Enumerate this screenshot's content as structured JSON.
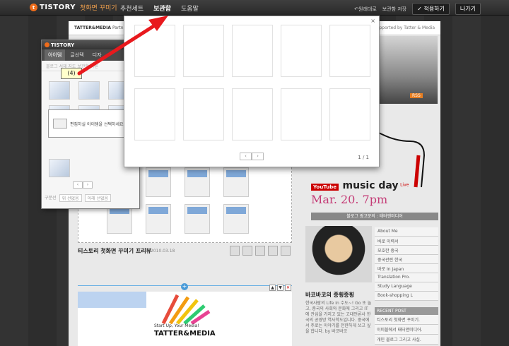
{
  "topbar": {
    "logo_mark": "t",
    "logo_text": "TISTORY",
    "logo_sub": "첫화면 꾸미기",
    "menu": [
      "추천세트",
      "보관함",
      "도움말"
    ],
    "undo_label": "↶원래대로",
    "save_label": "보관함 저장",
    "apply_label": "✓ 적용하기",
    "exit_label": "나가기"
  },
  "blog": {
    "header": "TATTER&MEDIA",
    "header_sub": "Partner Blo",
    "supported": "Supported by Tatter & Media",
    "rss": "RSS",
    "youtube": "YouTube",
    "music_title": "music day",
    "music_live": "Live",
    "music_date": "Mar. 20. 7pm",
    "banner": "블로그 광고문의 : 태터앤미디어",
    "profile_name": "바코바코의 종횡종횡",
    "profile_text": "한국사람의 Life In 수도~! Go 또 놀고, 중국의 사회와 문화에 그리고 IT에 관심을 가지고 있는 고대언론사 한국의 공영방 역사학도입니다. 중국에서 주로는 이야기를 전한하게 쓰고 싶을 합니다. by 바코바코",
    "side_list": [
      "About Me",
      "바로 이력서",
      "모호한 중국",
      "중국관련 한국",
      "바로 In Japan",
      "Translation Pro.",
      "Study Language",
      "Book-shopping L"
    ],
    "recent_head": "RECENT POST",
    "recent_items": [
      "티스토리 첫화면 꾸미기.",
      "이미블에서 태터앤미디어.",
      "개인 블로그 그리고 사실."
    ],
    "post_title": "티스토리 첫화면 꾸미기 프리뷰",
    "post_date": "2010.03.18",
    "tm_line": "Start Up, Your Media!",
    "tm_brand": "TATTER&MEDIA"
  },
  "item_panel": {
    "logo": "TISTORY",
    "tabs": [
      "아이템",
      "글선택",
      "디자"
    ],
    "sub_tabs": "블로그  서재  지도  보관함  다른",
    "tooltip": "(4)",
    "select_msg": "편집하실 아이템을 선택하세요",
    "pager_prev": "‹",
    "pager_next": "›",
    "footer_label": "구분선",
    "footer_sel1": "위 선없음",
    "footer_sel2": "아래 선없음"
  },
  "modal": {
    "close": "×",
    "pager_prev": "‹",
    "pager_next": "›",
    "count": "1 / 1"
  },
  "colors": {
    "accent": "#ef6c1a",
    "arrow": "#e8191d",
    "music_date": "#c43b76"
  }
}
